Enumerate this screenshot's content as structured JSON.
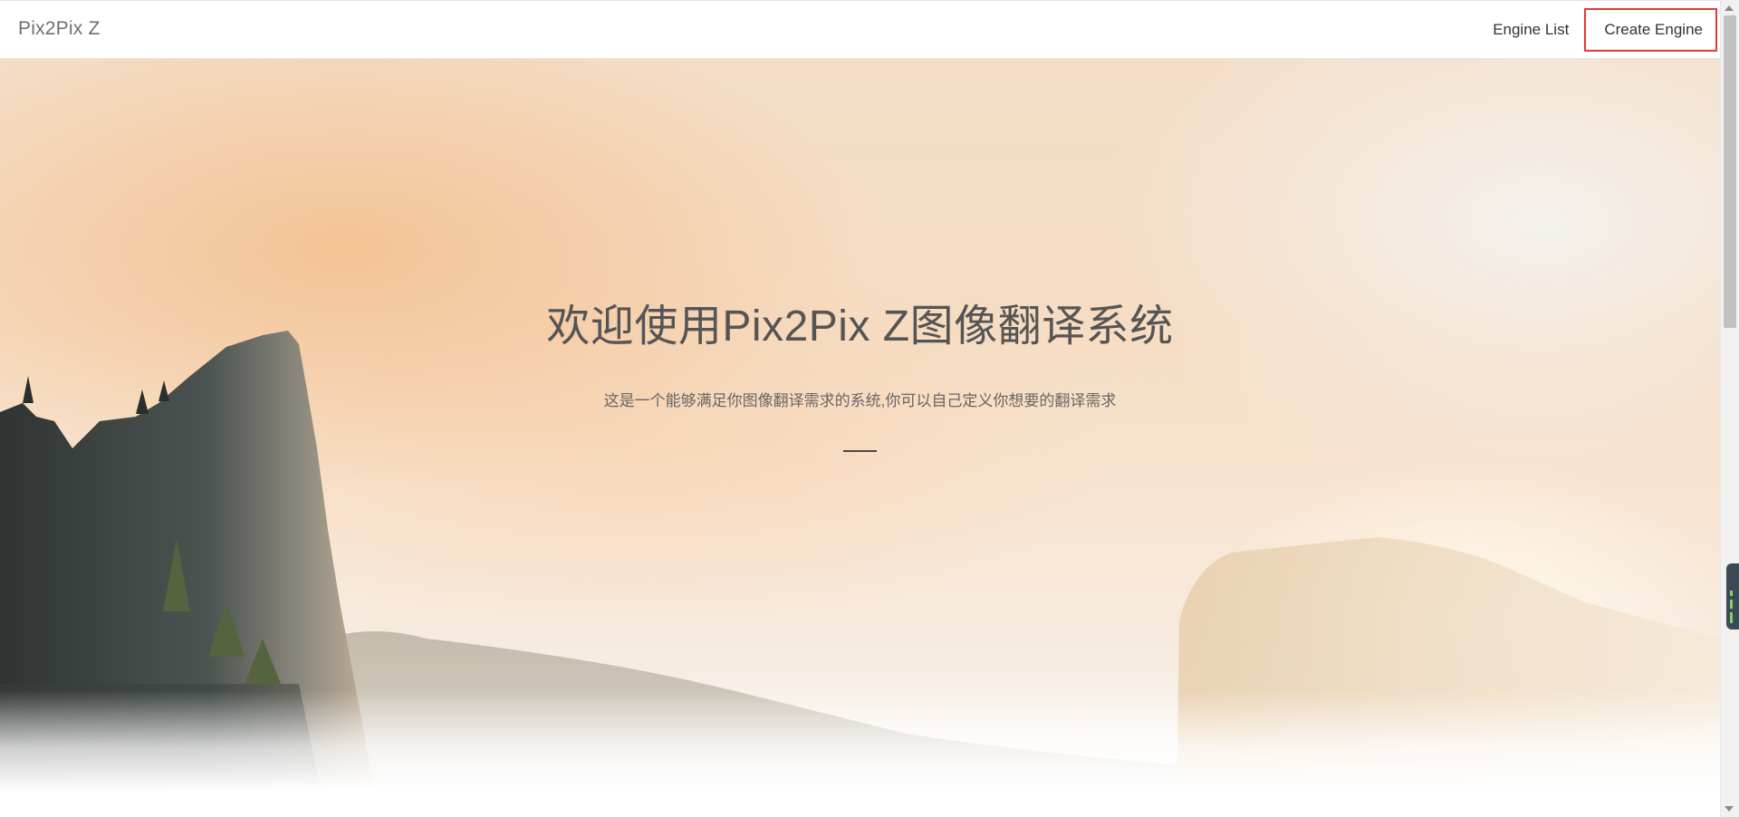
{
  "navbar": {
    "brand": "Pix2Pix Z",
    "links": [
      {
        "label": "Engine List"
      },
      {
        "label": "Create Engine",
        "highlighted": true
      }
    ]
  },
  "hero": {
    "title": "欢迎使用Pix2Pix Z图像翻译系统",
    "subtitle": "这是一个能够满足你图像翻译需求的系统,你可以自己定义你想要的翻译需求"
  },
  "colors": {
    "highlight_border": "#e53935",
    "title_text": "#555555",
    "subtitle_text": "#666666"
  }
}
